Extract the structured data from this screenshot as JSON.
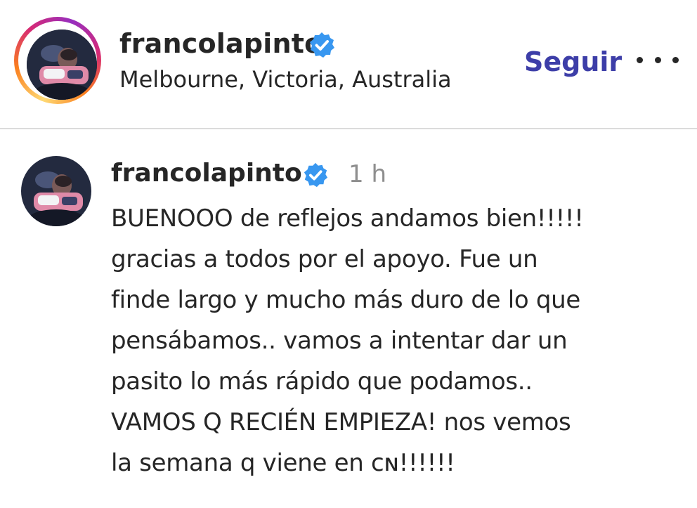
{
  "post_header": {
    "username": "francolapinto",
    "verified": true,
    "location": "Melbourne, Victoria, Australia",
    "follow_label": "Seguir",
    "more_icon": "more-horizontal-icon"
  },
  "caption": {
    "username": "francolapinto",
    "verified": true,
    "time_ago": "1 h",
    "lines": [
      "BUENOOO de reflejos andamos bien!!!!!",
      "gracias a todos por el apoyo. Fue un",
      "finde largo y mucho más duro de lo que",
      "pensábamos.. vamos a intentar dar un",
      "pasito lo más rápido que podamos..",
      "VAMOS Q RECIÉN EMPIEZA! nos vemos",
      "la semana q viene en ᴄɴ!!!!!!"
    ]
  },
  "colors": {
    "follow": "#3d3ea8",
    "verified": "#3897f0",
    "muted": "#8e8e8e",
    "divider": "#dbdbdb"
  }
}
